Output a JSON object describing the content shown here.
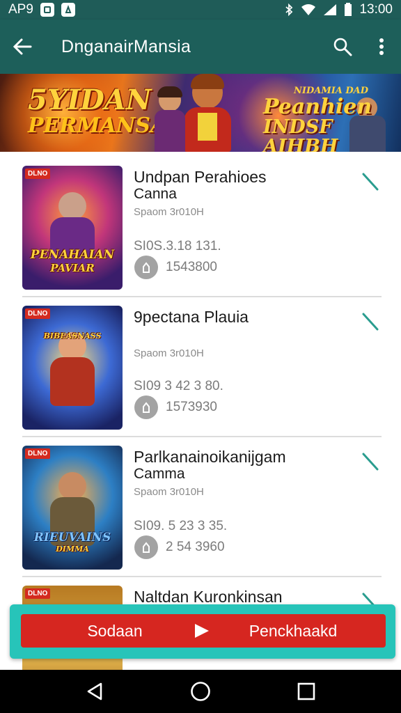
{
  "status_bar": {
    "left_text": "AP9",
    "time": "13:00",
    "icons": [
      "square-app-icon",
      "notification-app-icon",
      "bluetooth-icon",
      "wifi-icon",
      "signal-icon",
      "battery-icon"
    ]
  },
  "app_bar": {
    "title": "DnganairMansia",
    "icons": [
      "back-arrow-icon",
      "search-icon",
      "more-vert-icon"
    ]
  },
  "banner": {
    "left_line1": "5YIDAN",
    "left_line2": "PERMANSA",
    "right_line0": "NIDAMIA DAD",
    "right_line1": "Peanhien",
    "right_line2": "INDSF AIHBH"
  },
  "items": [
    {
      "tag": "DLNO",
      "thumb_caption_1": "PENAHAIAN",
      "thumb_caption_2": "PAVIAR",
      "name_line1": "Undpan Perahioes",
      "name_line2": "Canna",
      "subtitle": "Spaom 3r010H",
      "price": "SI0S.3.18 131.",
      "downloads": "1543800"
    },
    {
      "tag": "DLNO",
      "thumb_caption_1": "BIBEASNASS",
      "thumb_caption_2": "",
      "name_line1": "9pectana Plauia",
      "name_line2": "",
      "subtitle": "Spaom 3r010H",
      "price": "SI09 3 42 3 80.",
      "downloads": "1573930"
    },
    {
      "tag": "DLNO",
      "thumb_caption_1": "RIEUVAINS",
      "thumb_caption_2": "DIMMA",
      "name_line1": "Parlkanainoikanijgam",
      "name_line2": "Camma",
      "subtitle": "Spaom 3r010H",
      "price": "SI09. 5 23 3 35.",
      "downloads": "2 54 3960"
    },
    {
      "tag": "DLNO",
      "thumb_caption_1": "",
      "thumb_caption_2": "",
      "name_line1": "Naltdan Kuronkinsan",
      "name_line2": "",
      "subtitle": "",
      "price": "",
      "downloads": ""
    }
  ],
  "action_bar": {
    "left_label": "Sodaan",
    "right_label": "Penckhaakd"
  },
  "nav_bar": {
    "icons": [
      "nav-back-icon",
      "nav-home-icon",
      "nav-recents-icon"
    ]
  },
  "colors": {
    "app_bar": "#1d5f5a",
    "accent_teal": "#27c4b9",
    "action_red": "#d62620",
    "check_teal": "#2a9d8f"
  }
}
